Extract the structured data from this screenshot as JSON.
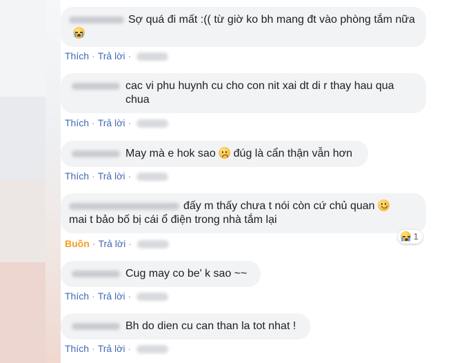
{
  "actions": {
    "like": "Thích",
    "reply": "Trả lời",
    "reacted_sad": "Buồn",
    "separator": "·"
  },
  "comments": [
    {
      "text": "Sợ quá đi mất :(( từ giờ ko bh mang đt vào phòng tắm nữa",
      "emoji": "crying-face-icon"
    },
    {
      "text": "cac vi phu huynh cu cho con nit xai dt di r thay hau qua chua"
    },
    {
      "text_before": "May mà e hok sao",
      "text_after": "đúg là cẩn thận vẫn hơn",
      "emoji": "sad-face-icon"
    },
    {
      "line1": "đấy m thấy chưa t nói còn cứ chủ quan",
      "line2": "mai t bảo bố bị cái ổ điện trong nhà tắm lại",
      "emoji": "smile-face-icon",
      "reaction_count": "1",
      "reaction_icon": "crying-face-icon"
    },
    {
      "text": "Cug may co be' k sao ~~"
    },
    {
      "text": "Bh do dien cu can than la tot nhat !"
    }
  ],
  "colors": {
    "link": "#4267b2",
    "reacted": "#f0a020",
    "bubble": "#f2f3f5",
    "meta": "#606770"
  }
}
